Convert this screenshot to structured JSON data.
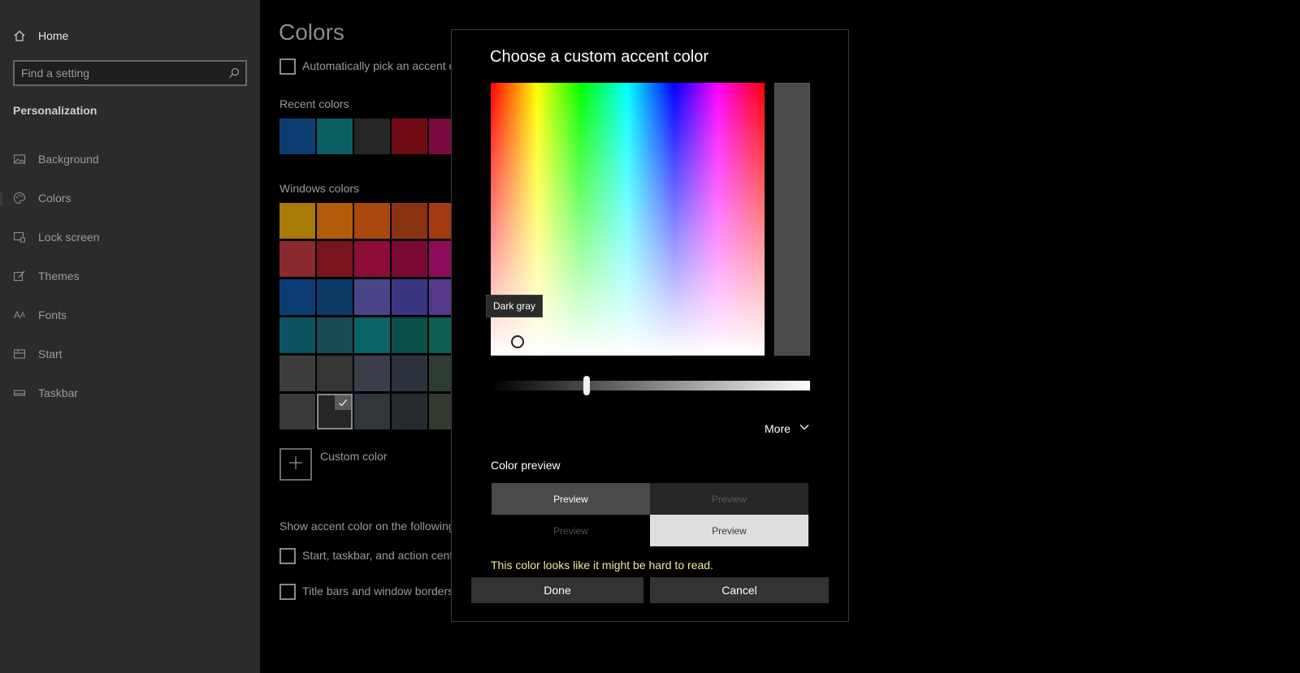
{
  "sidebar": {
    "home_label": "Home",
    "search_placeholder": "Find a setting",
    "section_label": "Personalization",
    "items": [
      {
        "label": "Background"
      },
      {
        "label": "Colors"
      },
      {
        "label": "Lock screen"
      },
      {
        "label": "Themes"
      },
      {
        "label": "Fonts"
      },
      {
        "label": "Start"
      },
      {
        "label": "Taskbar"
      }
    ]
  },
  "main": {
    "title": "Colors",
    "auto_pick_label": "Automatically pick an accent c",
    "recent_colors_label": "Recent colors",
    "recent_colors": [
      "#0b3d73",
      "#0a5f63",
      "#262626",
      "#6e0b13",
      "#7a0b40"
    ],
    "windows_colors_label": "Windows colors",
    "windows_colors": [
      [
        "#a87a06",
        "#b05c0a",
        "#a9470c",
        "#8a3211",
        "#a33a10"
      ],
      [
        "#8a2a2f",
        "#78141b",
        "#8c0c3a",
        "#7a0a34",
        "#8c0c5a"
      ],
      [
        "#0b3d73",
        "#0b3a66",
        "#4a4488",
        "#3a3580",
        "#55388a"
      ],
      [
        "#0b5360",
        "#184b55",
        "#0a6366",
        "#0b4f4a",
        "#0b6052"
      ],
      [
        "#3d3d3d",
        "#363434",
        "#3a3e48",
        "#2d333c",
        "#2e3c34"
      ],
      [
        "#3a3a3a",
        "#262626",
        "#30363a",
        "#262b30",
        "#323a30"
      ]
    ],
    "custom_color_label": "Custom color",
    "show_accent_label": "Show accent color on the following",
    "start_taskbar_label": "Start, taskbar, and action cente",
    "title_bars_label": "Title bars and window borders"
  },
  "dialog": {
    "title": "Choose a custom accent color",
    "tooltip": "Dark gray",
    "slider_value": 0.3,
    "more_label": "More",
    "color_preview_label": "Color preview",
    "preview_text": "Preview",
    "warning": "This color looks like it might be hard to read.",
    "done_label": "Done",
    "cancel_label": "Cancel",
    "selected_color": "#4a4a4a"
  }
}
